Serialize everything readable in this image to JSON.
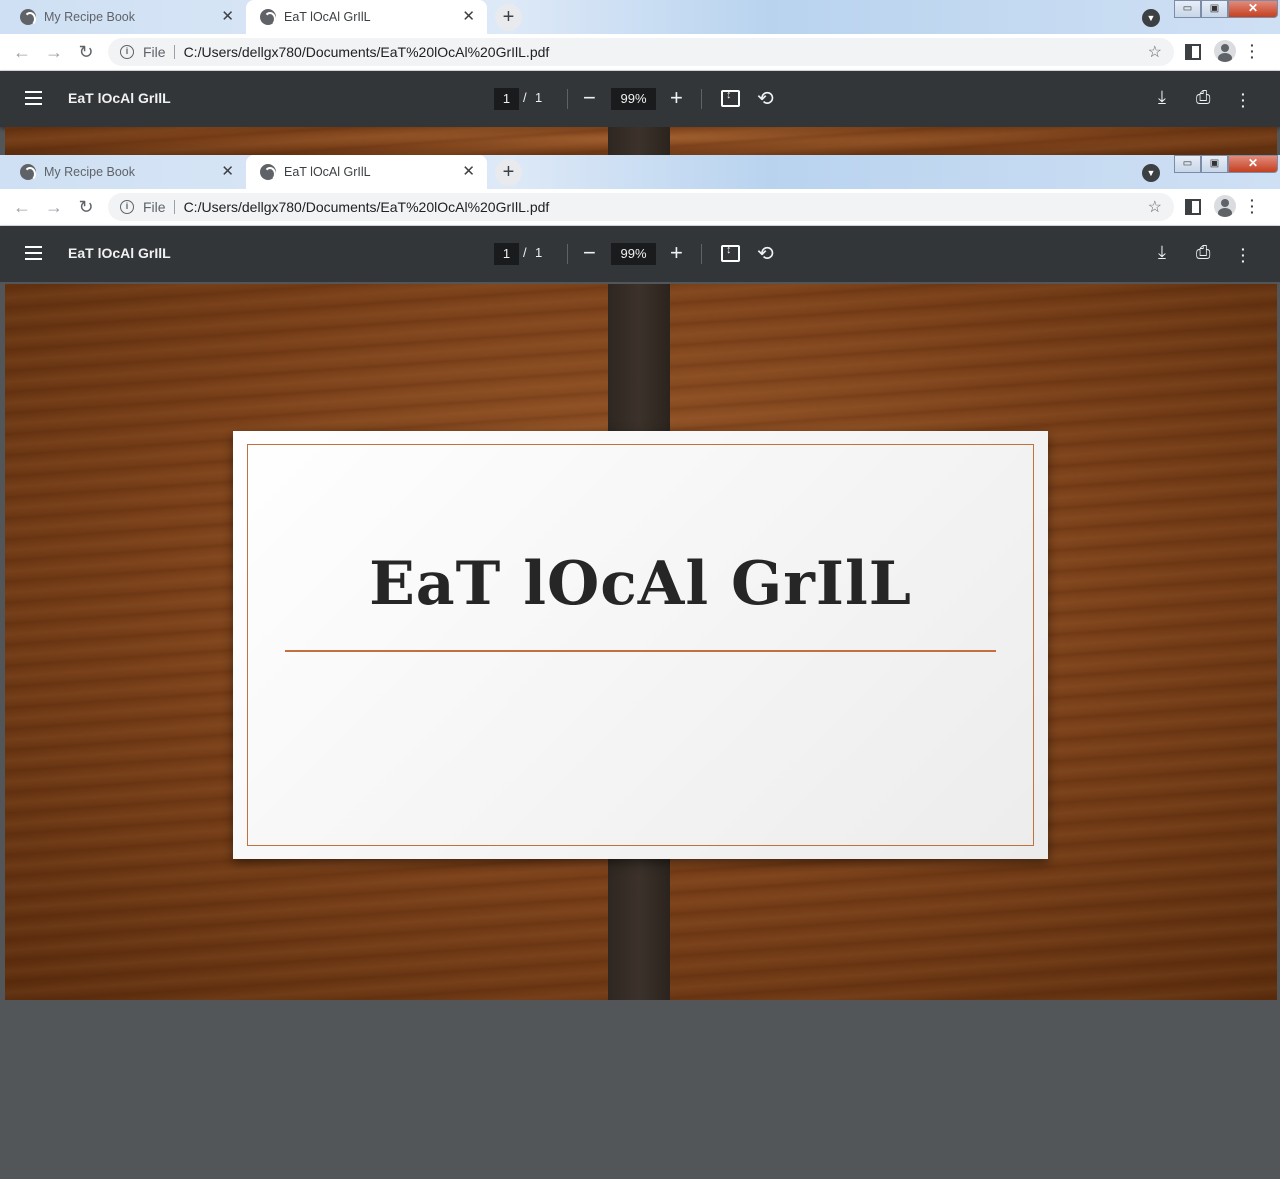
{
  "browser": {
    "tabs": [
      {
        "title": "My Recipe Book",
        "active": false
      },
      {
        "title": "EaT lOcAl GrIlL",
        "active": true
      }
    ],
    "new_tab_label": "+",
    "address": {
      "scheme_label": "File",
      "url": "C:/Users/dellgx780/Documents/EaT%20lOcAl%20GrIlL.pdf"
    },
    "window_buttons": {
      "minimize": "▭",
      "maximize": "▣",
      "close": "✕"
    }
  },
  "pdf_toolbar": {
    "title": "EaT lOcAl GrIlL",
    "page_current": "1",
    "page_separator": "/",
    "page_total": "1",
    "zoom": "99%",
    "zoom_out": "−",
    "zoom_in": "+"
  },
  "slide": {
    "title": "EaT lOcAl GrIlL"
  },
  "icons": {
    "back": "back-arrow-icon",
    "forward": "forward-arrow-icon",
    "reload": "reload-icon",
    "info": "info-icon",
    "star": "bookmark-star-icon",
    "menu": "hamburger-menu-icon",
    "fit": "fit-to-page-icon",
    "rotate": "rotate-counterclockwise-icon",
    "download": "download-icon",
    "print": "print-icon",
    "more": "more-vertical-icon"
  },
  "colors": {
    "pdf_toolbar_bg": "#323639",
    "card_accent": "#c0713d",
    "viewer_bg": "#525659"
  }
}
